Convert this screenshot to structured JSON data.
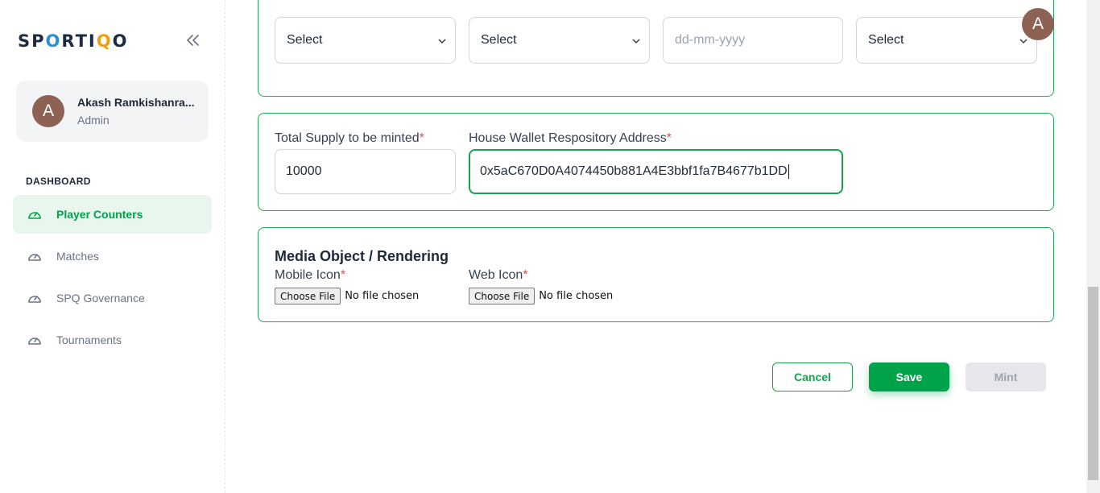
{
  "brand": {
    "logo_text_parts": [
      "SP",
      "O",
      "RTI",
      "Q",
      "O"
    ]
  },
  "sidebar": {
    "user": {
      "initial": "A",
      "name": "Akash Ramkishanra...",
      "role": "Admin"
    },
    "section_label": "DASHBOARD",
    "items": [
      {
        "label": "Player Counters",
        "active": true
      },
      {
        "label": "Matches",
        "active": false
      },
      {
        "label": "SPQ Governance",
        "active": false
      },
      {
        "label": "Tournaments",
        "active": false
      }
    ]
  },
  "header": {
    "avatar_initial": "A"
  },
  "filters": {
    "select1": "Select",
    "select2": "Select",
    "date_placeholder": "dd-mm-yyyy",
    "select3": "Select"
  },
  "supply": {
    "total_label": "Total Supply to be minted",
    "total_value": "10000",
    "wallet_label": "House Wallet Respository Address",
    "wallet_value": "0x5aC670D0A4074450b881A4E3bbf1fa7B4677b1DD",
    "required_mark": "*"
  },
  "media": {
    "title": "Media Object / Rendering",
    "mobile_label": "Mobile Icon",
    "web_label": "Web Icon",
    "choose_file": "Choose File",
    "no_file": "No file chosen"
  },
  "actions": {
    "cancel": "Cancel",
    "save": "Save",
    "mint": "Mint"
  },
  "colors": {
    "accent": "#00a34a",
    "active_bg": "#e8f6ee",
    "avatar": "#8d6154",
    "border": "#1faa5a"
  }
}
